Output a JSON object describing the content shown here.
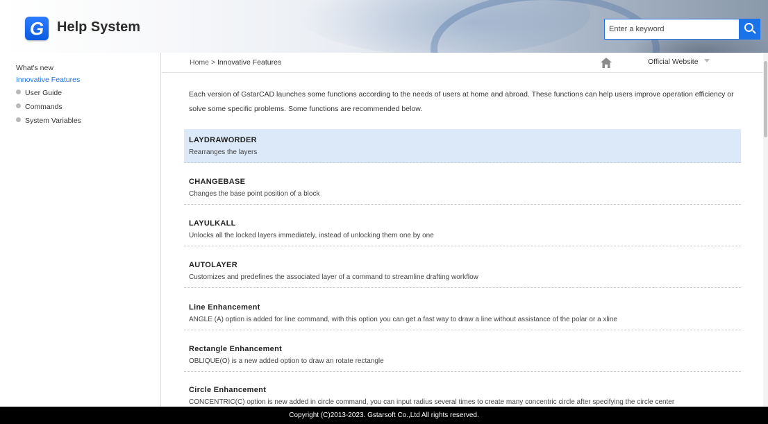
{
  "header": {
    "logo_letter": "G",
    "title": "Help System",
    "search_placeholder": "Enter a keyword"
  },
  "sidebar": {
    "items": [
      {
        "label": "What's new",
        "bullet": false,
        "active": false
      },
      {
        "label": "Innovative Features",
        "bullet": false,
        "active": true
      },
      {
        "label": "User Guide",
        "bullet": true,
        "active": false
      },
      {
        "label": "Commands",
        "bullet": true,
        "active": false
      },
      {
        "label": "System Variables",
        "bullet": true,
        "active": false
      }
    ]
  },
  "breadcrumb": {
    "home": "Home",
    "separator": ">",
    "current": "Innovative Features"
  },
  "official_website": "Official Website",
  "intro": "Each version of GstarCAD launches some functions according to the needs of users at home and abroad. These functions can help users improve operation efficiency or solve some specific problems. Some functions are recommended below.",
  "features": [
    {
      "title": "LAYDRAWORDER",
      "desc": "Rearranges the layers",
      "highlighted": true
    },
    {
      "title": "CHANGEBASE",
      "desc": "Changes the base point position of a block",
      "highlighted": false
    },
    {
      "title": "LAYULKALL",
      "desc": "Unlocks all the locked layers immediately, instead of unlocking them one by one",
      "highlighted": false
    },
    {
      "title": "AUTOLAYER",
      "desc": "Customizes and predefines the associated layer of a command to streamline drafting workflow",
      "highlighted": false
    },
    {
      "title": "Line Enhancement",
      "desc": "ANGLE (A) option is added for line command, with this option you can get a fast way to draw a line without assistance of the polar or a xline",
      "highlighted": false
    },
    {
      "title": "Rectangle Enhancement",
      "desc": "OBLIQUE(O) is a new added option to draw an rotate rectangle",
      "highlighted": false
    },
    {
      "title": "Circle Enhancement",
      "desc": "CONCENTRIC(C) option is new added in circle command, you can input radius several times to create many concentric circle after specifying the circle center",
      "highlighted": false
    }
  ],
  "footer": "Copyright (C)2013-2023. Gstarsoft Co.,Ltd All rights reserved.",
  "colors": {
    "accent": "#1a73e8",
    "highlight_row": "#dbe9f8",
    "footer_bg": "#000000"
  }
}
